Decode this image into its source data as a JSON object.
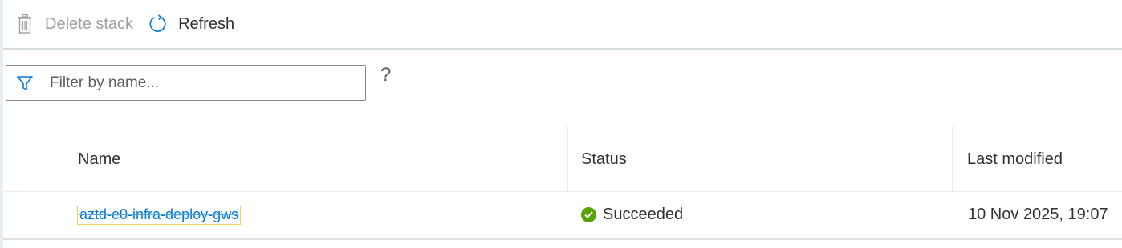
{
  "toolbar": {
    "delete_label": "Delete stack",
    "refresh_label": "Refresh"
  },
  "filter": {
    "placeholder": "Filter by name...",
    "value": "",
    "help_label": "?"
  },
  "table": {
    "columns": [
      "Name",
      "Status",
      "Last modified"
    ],
    "rows": [
      {
        "name": "aztd-e0-infra-deploy-gws",
        "status": "Succeeded",
        "last_modified": "10 Nov 2025, 19:07"
      }
    ]
  },
  "colors": {
    "accent": "#0078d4",
    "success": "#57a300",
    "disabled": "#a19f9d"
  }
}
